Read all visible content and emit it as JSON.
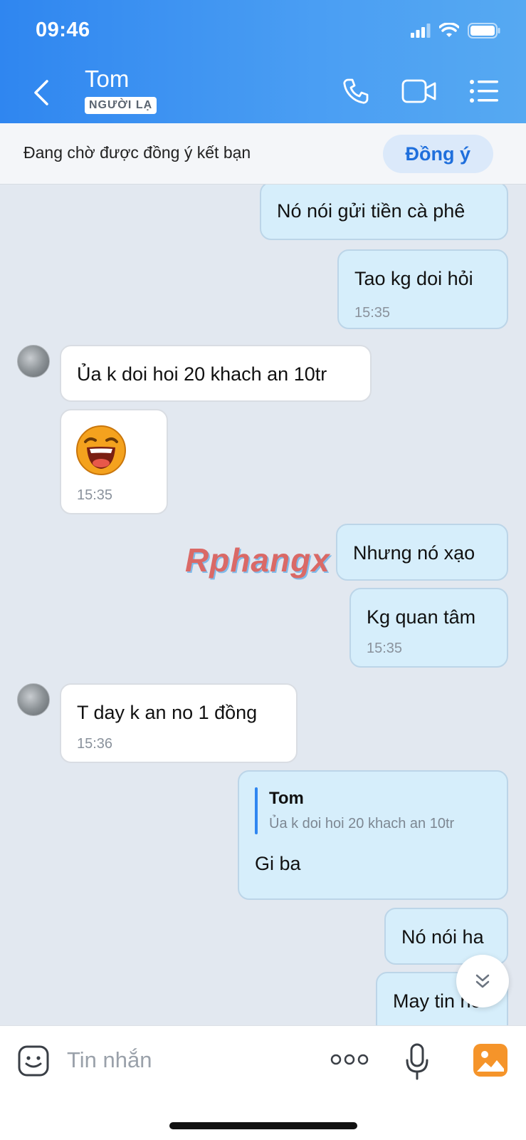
{
  "status_bar": {
    "time": "09:46"
  },
  "header": {
    "contact_name": "Tom",
    "badge": "NGƯỜI LẠ",
    "icons": [
      "back-chevron-icon",
      "phone-icon",
      "video-camera-icon",
      "list-menu-icon"
    ]
  },
  "pending": {
    "text": "Đang chờ được đồng ý kết bạn",
    "accept_label": "Đồng ý"
  },
  "messages": [
    {
      "dir": "out",
      "text": "Nó nói gửi tiền cà phê"
    },
    {
      "dir": "out",
      "text": "Tao kg doi hỏi",
      "time": "15:35"
    },
    {
      "dir": "in",
      "text": "Ủa k doi hoi 20 khach an 10tr"
    },
    {
      "dir": "in",
      "sticker": "laughing-face-sticker",
      "time": "15:35"
    },
    {
      "dir": "out",
      "text": "Nhưng nó xạo"
    },
    {
      "dir": "out",
      "text": "Kg quan tâm",
      "time": "15:35"
    },
    {
      "dir": "in",
      "text": "T day k an no 1 đồng",
      "time": "15:36"
    },
    {
      "dir": "out",
      "quote_name": "Tom",
      "quote_text": "Ủa k doi hoi 20 khach an 10tr",
      "text": "Gi ba"
    },
    {
      "dir": "out",
      "text": "Nó nói ha"
    },
    {
      "dir": "out",
      "text": "May tin no"
    }
  ],
  "watermark": "Rphangx",
  "input": {
    "placeholder": "Tin nhắn",
    "icons": [
      "sticker-face-icon",
      "more-dots-icon",
      "microphone-icon",
      "gallery-image-icon"
    ]
  },
  "colors": {
    "header_blue": "#2f86f0",
    "outgoing_bubble": "#d6eefb",
    "accent": "#1f6fdc"
  }
}
